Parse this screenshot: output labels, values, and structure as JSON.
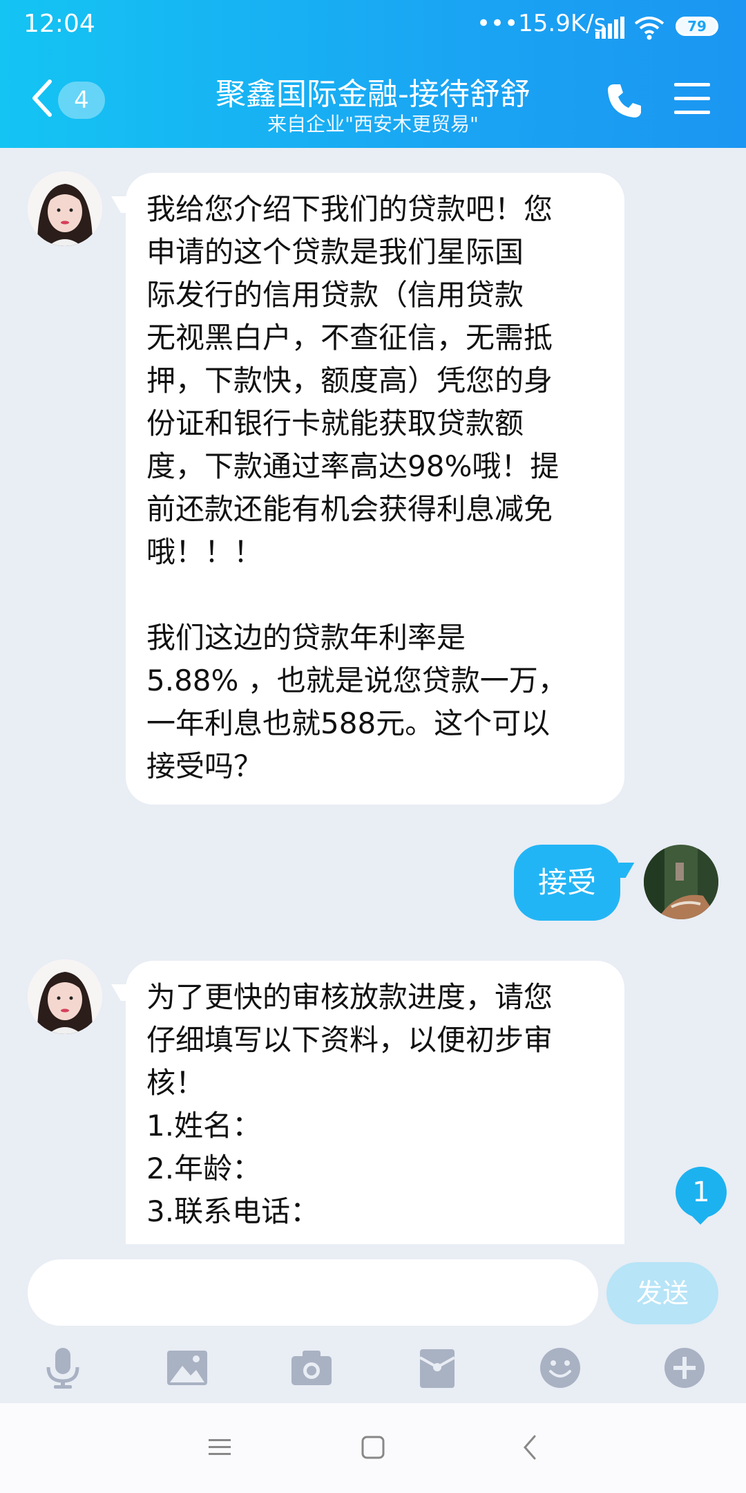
{
  "status": {
    "time": "12:04",
    "speed": "15.9K/s",
    "battery": "79"
  },
  "header": {
    "unread_count": "4",
    "title": "聚鑫国际金融-接待舒舒",
    "subtitle": "来自企业\"西安木更贸易\""
  },
  "messages": [
    {
      "direction": "incoming",
      "lines": [
        "我给您介绍下我们的贷款吧！您",
        "申请的这个贷款是我们星际国",
        "际发行的信用贷款（信用贷款",
        "无视黑白户，不查征信，无需抵",
        "押，下款快，额度高）凭您的身",
        "份证和银行卡就能获取贷款额",
        "度，下款通过率高达98%哦！提",
        "前还款还能有机会获得利息减免",
        "哦！！！",
        "",
        "我们这边的贷款年利率是",
        "5.88% ，也就是说您贷款一万，",
        "一年利息也就588元。这个可以",
        "接受吗？"
      ]
    },
    {
      "direction": "outgoing",
      "text": "接受"
    },
    {
      "direction": "incoming",
      "lines": [
        "为了更快的审核放款进度，请您",
        "仔细填写以下资料，以便初步审",
        "核！",
        "1.姓名：",
        "2.年龄：",
        "3.联系电话："
      ]
    }
  ],
  "new_message_count": "1",
  "input": {
    "value": "",
    "placeholder": ""
  },
  "send_label": "发送",
  "toolbar_icons": [
    "microphone-icon",
    "image-icon",
    "camera-icon",
    "red-packet-icon",
    "emoji-icon",
    "plus-icon"
  ],
  "colors": {
    "header_start": "#14c4f3",
    "header_end": "#1b96f2",
    "outgoing_bubble": "#22b5f5",
    "background": "#e9edf4"
  }
}
